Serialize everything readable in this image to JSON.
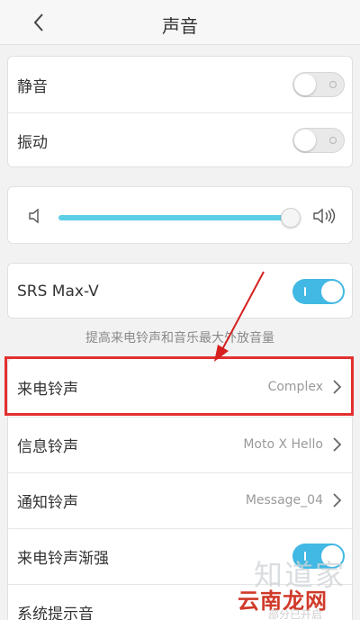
{
  "header": {
    "title": "声音"
  },
  "toggles_card": {
    "items": [
      {
        "label": "静音",
        "state": "off"
      },
      {
        "label": "振动",
        "state": "off"
      }
    ]
  },
  "volume": {
    "level": 0.97
  },
  "srs": {
    "label": "SRS Max-V",
    "state": "on",
    "hint": "提高来电铃声和音乐最大外放音量"
  },
  "sound_list": {
    "items": [
      {
        "label": "来电铃声",
        "value": "Complex"
      },
      {
        "label": "信息铃声",
        "value": "Moto X Hello"
      },
      {
        "label": "通知铃声",
        "value": "Message_04"
      },
      {
        "label": "来电铃声渐强",
        "state": "on"
      },
      {
        "label": "系统提示音"
      }
    ]
  },
  "watermark": {
    "top": "知道家",
    "main": "云南龙网",
    "sub": "部分已开启"
  },
  "colors": {
    "accent": "#42b8e4",
    "slider": "#5ccfe6",
    "annotation": "#e33030"
  }
}
